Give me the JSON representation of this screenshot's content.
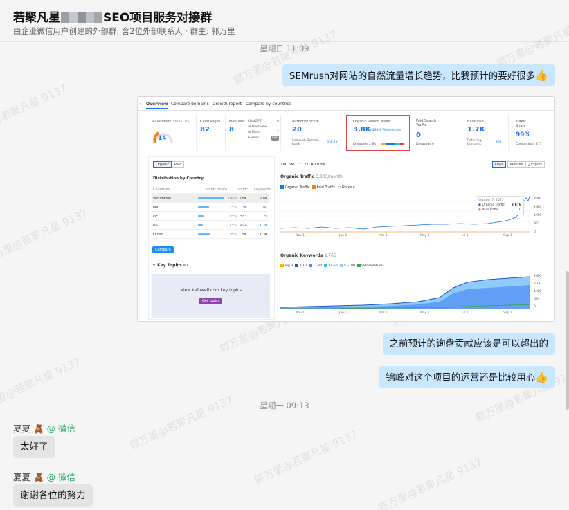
{
  "header": {
    "title_prefix": "若聚凡星",
    "title_suffix": "SEO项目服务对接群",
    "subtitle": "由企业微信用户创建的外部群, 含2位外部联系人 · 群主: 郭万里"
  },
  "watermark": "郭万里@若聚凡星 9137",
  "messages": {
    "time1": "星期日 11:09",
    "msg1": "SEMrush对网站的自然流量增长趋势，比我预计的要好很多",
    "msg2": "之前预计的询盘贡献应该是可以超出的",
    "msg3": "锦峰对这个项目的运营还是比较用心",
    "time2": "星期一 09:13",
    "sender1_name": "夏夏",
    "sender1_tag": "@ 微信",
    "msg4": "太好了",
    "sender2_name": "夏夏",
    "sender2_tag": "@ 微信",
    "msg5": "谢谢各位的努力"
  },
  "screenshot": {
    "tabs": [
      "Overview",
      "Compare domains",
      "Growth report",
      "Compare by countries"
    ],
    "ai_visibility_label": "AI Visibility",
    "ai_visibility_sub": "Today, US",
    "ai_visibility_value": "14",
    "cited_pages_label": "Cited Pages",
    "cited_pages_value": "82",
    "mentions_label": "Mentions",
    "mentions_value": "8",
    "mentions_sources": [
      {
        "name": "ChatGPT",
        "value": "0"
      },
      {
        "name": "AI Overview",
        "value": "1"
      },
      {
        "name": "AI Mode",
        "value": "7"
      },
      {
        "name": "Gemini",
        "value": "new"
      }
    ],
    "authority_label": "Authority Score",
    "authority_value": "20",
    "semrush_rank_label": "Semrush Domain Rank",
    "semrush_rank_value": "900.1K",
    "organic_label": "Organic Search Traffic",
    "organic_value": "3.8K",
    "organic_change": "+194%",
    "organic_details": "View details",
    "keywords_label": "Keywords 2.8K",
    "paid_label": "Paid Search Traffic",
    "paid_value": "0",
    "paid_keywords": "Keywords 0",
    "backlinks_label": "Backlinks",
    "backlinks_value": "1.7K",
    "referring_label": "Referring Domains",
    "referring_value": "498",
    "traffic_share_label": "Traffic Share",
    "traffic_share_value": "99%",
    "competitors_label": "Competitors 277",
    "toggle_organic": "Organic",
    "toggle_paid": "Paid",
    "periods": [
      "1M",
      "6M",
      "1Y",
      "2Y",
      "All time"
    ],
    "days_label": "Days",
    "months_label": "Months",
    "export_label": "Export",
    "distribution_title": "Distribution by Country",
    "table_headers": [
      "Countries",
      "Traffic Share",
      "Traffic",
      "Keywords"
    ],
    "table_rows": [
      {
        "country": "Worldwide",
        "share": "100%",
        "traffic": "3.8K",
        "keywords": "2.8K"
      },
      {
        "country": "MX",
        "share": "33%",
        "traffic": "1.3K",
        "keywords": "80"
      },
      {
        "country": "DE",
        "share": "15%",
        "traffic": "583",
        "keywords": "129"
      },
      {
        "country": "US",
        "share": "13%",
        "traffic": "494",
        "keywords": "1.2K"
      },
      {
        "country": "Other",
        "share": "38%",
        "traffic": "1.5K",
        "keywords": "1.3K"
      }
    ],
    "compare_button": "Compare",
    "key_topics_label": "Key Topics",
    "key_topics_country": "MX",
    "key_topics_text": "View kafuwell.com key topics",
    "get_topics_button": "Get topics",
    "organic_traffic_title": "Organic Traffic",
    "organic_traffic_sub": "3,803/month",
    "legend_organic": "Organic Traffic",
    "legend_paid": "Paid Traffic",
    "notes_label": "Notes",
    "tooltip_date": "October 7, 2025",
    "tooltip_organic": "Organic Traffic",
    "tooltip_organic_value": "3,676",
    "tooltip_paid": "Paid Traffic",
    "tooltip_paid_value": "0",
    "traffic_y_ticks": [
      "3.8K",
      "2.8K",
      "1.9K",
      "952",
      "0"
    ],
    "months_axis": [
      "Nov 1",
      "Jan 1",
      "Mar 1",
      "May 1",
      "Jul 1",
      "Sep 1"
    ],
    "organic_keywords_title": "Organic Keywords",
    "organic_keywords_sub": "2,766",
    "kw_legend": [
      "Top 3",
      "4-10",
      "11-20",
      "21-50",
      "51-100",
      "SERP Features"
    ],
    "kw_y_ticks": [
      "2.8K",
      "2.1K",
      "1.4K",
      "693",
      "0"
    ]
  }
}
